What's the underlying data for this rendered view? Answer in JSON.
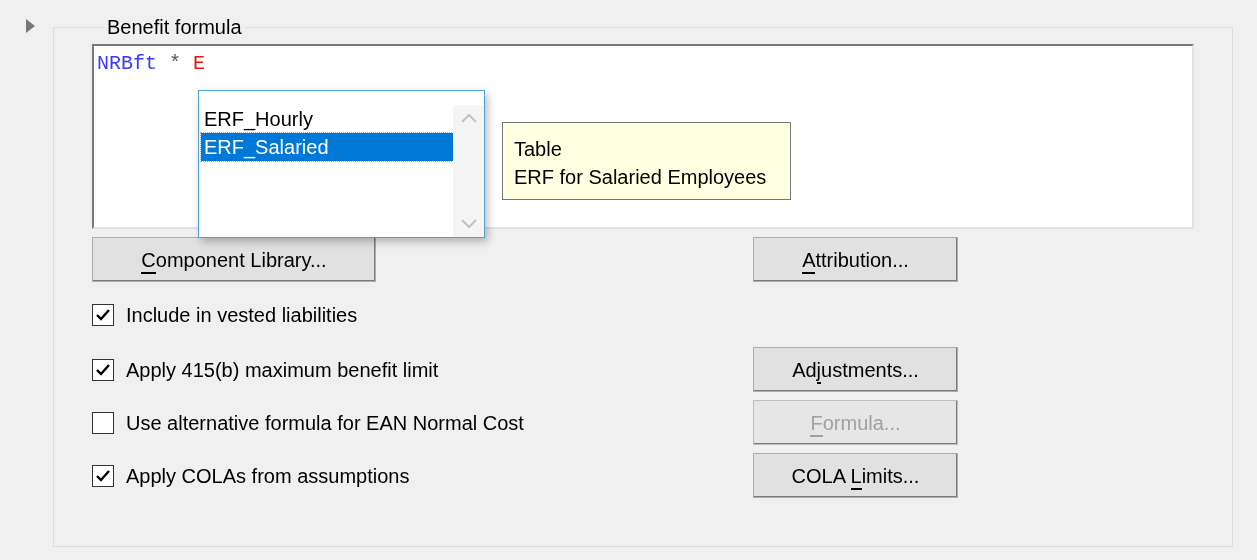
{
  "expander": {
    "expanded": false
  },
  "group": {
    "title": "Benefit formula"
  },
  "formula": {
    "tokens": [
      {
        "text": "NRBft",
        "color": "#3b3bf5"
      },
      {
        "text": "*",
        "color": "#555555"
      },
      {
        "text": "E",
        "color": "#ee1111"
      }
    ]
  },
  "autocomplete": {
    "items": [
      {
        "text": "ERF_Hourly",
        "selected": false
      },
      {
        "text": "ERF_Salaried",
        "selected": true
      }
    ]
  },
  "tooltip": {
    "lines": [
      "Table",
      "ERF for Salaried Employees"
    ]
  },
  "rows": [
    {
      "left": {
        "kind": "button",
        "label": [
          {
            "text": "C",
            "underline": true
          },
          {
            "text": "omponent Library..."
          }
        ],
        "disabled": false
      },
      "right": {
        "label": [
          {
            "text": "A",
            "underline": true
          },
          {
            "text": "ttribution..."
          }
        ],
        "disabled": false
      }
    },
    {
      "left": {
        "kind": "checkbox",
        "label": "Include in vested liabilities",
        "checked": true
      }
    },
    {
      "left": {
        "kind": "checkbox",
        "label": "Apply 415(b) maximum benefit limit",
        "checked": true
      },
      "right": {
        "label": [
          {
            "text": "Ad"
          },
          {
            "text": "j",
            "underline": true
          },
          {
            "text": "ustments..."
          }
        ],
        "disabled": false
      }
    },
    {
      "left": {
        "kind": "checkbox",
        "label": "Use alternative formula for EAN Normal Cost",
        "checked": false
      },
      "right": {
        "label": [
          {
            "text": "F",
            "underline": true
          },
          {
            "text": "ormula..."
          }
        ],
        "disabled": true
      }
    },
    {
      "left": {
        "kind": "checkbox",
        "label": "Apply COLAs from assumptions",
        "checked": true
      },
      "right": {
        "label": [
          {
            "text": "COLA "
          },
          {
            "text": "L",
            "underline": true
          },
          {
            "text": "imits..."
          }
        ],
        "disabled": false
      }
    }
  ]
}
